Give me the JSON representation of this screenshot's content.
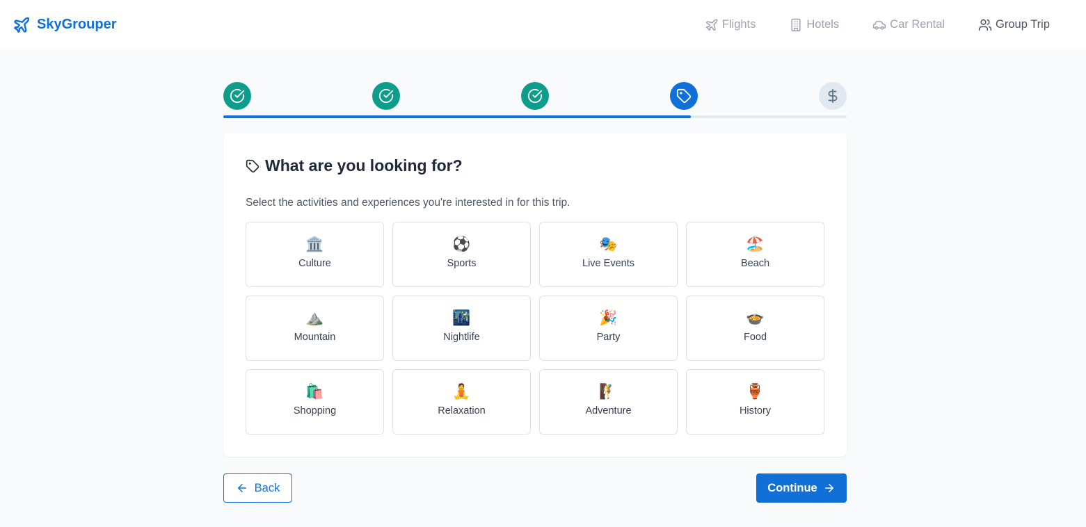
{
  "app": {
    "brand_name": "SkyGrouper",
    "brand_icon": "plane-icon",
    "accent_color": "#1170d8"
  },
  "nav": {
    "items": [
      {
        "label": "Flights",
        "icon": "plane-icon",
        "active": false
      },
      {
        "label": "Hotels",
        "icon": "building-icon",
        "active": false
      },
      {
        "label": "Car Rental",
        "icon": "car-icon",
        "active": false
      },
      {
        "label": "Group Trip",
        "icon": "users-icon",
        "active": true
      }
    ]
  },
  "steps": {
    "items": [
      {
        "status": "complete",
        "icon": "check-circle-icon"
      },
      {
        "status": "complete",
        "icon": "check-circle-icon"
      },
      {
        "status": "complete",
        "icon": "check-circle-icon"
      },
      {
        "status": "current",
        "icon": "tag-icon"
      },
      {
        "status": "pending",
        "icon": "dollar-icon"
      }
    ],
    "progress_fraction": 0.75,
    "complete_color": "#0e9d8a",
    "current_color": "#1170d8"
  },
  "card": {
    "title": "What are you looking for?",
    "title_icon": "tag-icon",
    "subtitle": "Select the activities and experiences you're interested in for this trip.",
    "activities": [
      {
        "label": "Culture",
        "emoji": "🏛️"
      },
      {
        "label": "Sports",
        "emoji": "⚽"
      },
      {
        "label": "Live Events",
        "emoji": "🎭"
      },
      {
        "label": "Beach",
        "emoji": "🏖️"
      },
      {
        "label": "Mountain",
        "emoji": "⛰️"
      },
      {
        "label": "Nightlife",
        "emoji": "🌃"
      },
      {
        "label": "Party",
        "emoji": "🎉"
      },
      {
        "label": "Food",
        "emoji": "🍲"
      },
      {
        "label": "Shopping",
        "emoji": "🛍️"
      },
      {
        "label": "Relaxation",
        "emoji": "🧘"
      },
      {
        "label": "Adventure",
        "emoji": "🧗"
      },
      {
        "label": "History",
        "emoji": "🏺"
      }
    ]
  },
  "buttons": {
    "back_label": "Back",
    "continue_label": "Continue"
  }
}
